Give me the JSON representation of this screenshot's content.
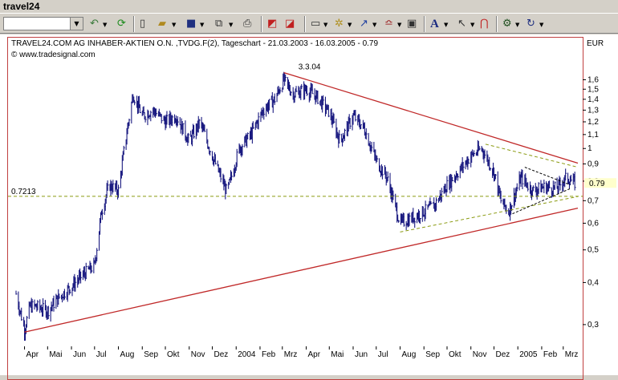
{
  "window": {
    "title": "travel24"
  },
  "toolbar": {
    "combo_value": "",
    "icons": [
      "undo-icon",
      "refresh-icon",
      "new-icon",
      "open-icon",
      "save-icon",
      "copy-icon",
      "print-icon",
      "chart-icon",
      "chart-compare-icon",
      "layout-icon",
      "indicator-icon",
      "drawing-icon",
      "scale-icon",
      "properties-icon",
      "text-icon",
      "cursor-icon",
      "magnet-icon",
      "settings-icon",
      "reload-icon"
    ]
  },
  "chart": {
    "header": "TRAVEL24.COM AG INHABER-AKTIEN O.N. ,TVDG.F(2), Tageschart - 21.03.2003 - 16.03.2005 - 0.79",
    "copyright": "© www.tradesignal.com",
    "currency": "EUR",
    "annotation_peak": "3.3.04",
    "hline_label": "0.7213",
    "last_price_label": "0.79",
    "colors": {
      "price": "#1a1a80",
      "trend": "#c02828",
      "hline": "#8a9a10",
      "background": "#ffffff"
    }
  },
  "chart_data": {
    "type": "line",
    "title": "TRAVEL24.COM AG INHABER-AKTIEN O.N. ,TVDG.F(2), Tageschart - 21.03.2003 - 16.03.2005 - 0.79",
    "xlabel": "",
    "ylabel": "EUR",
    "log_scale": true,
    "ylim": [
      0.26,
      1.85
    ],
    "x_ticks": [
      "Apr",
      "Mai",
      "Jun",
      "Jul",
      "Aug",
      "Sep",
      "Okt",
      "Nov",
      "Dez",
      "2004",
      "Feb",
      "Mrz",
      "Apr",
      "Mai",
      "Jun",
      "Jul",
      "Aug",
      "Sep",
      "Okt",
      "Nov",
      "Dez",
      "2005",
      "Feb",
      "Mrz"
    ],
    "y_ticks": [
      "1,6",
      "1,5",
      "1,4",
      "1,3",
      "1,2",
      "1,1",
      "1",
      "0,9",
      "0,8",
      "0,7",
      "0,6",
      "0,5",
      "0,4",
      "0,3"
    ],
    "series": [
      {
        "x": [
          "2003-03-21",
          "2003-04-01",
          "2003-04-08",
          "2003-04-15",
          "2003-05-01",
          "2003-05-15",
          "2003-06-01",
          "2003-06-15",
          "2003-07-01",
          "2003-07-10",
          "2003-07-20",
          "2003-08-01",
          "2003-08-10",
          "2003-08-20",
          "2003-09-01",
          "2003-09-15",
          "2003-10-01",
          "2003-10-15",
          "2003-11-01",
          "2003-11-15",
          "2003-12-01",
          "2003-12-20",
          "2004-01-05",
          "2004-01-20",
          "2004-02-05",
          "2004-02-20",
          "2004-03-03",
          "2004-03-15",
          "2004-04-01",
          "2004-04-15",
          "2004-05-01",
          "2004-05-15",
          "2004-06-01",
          "2004-06-15",
          "2004-07-01",
          "2004-07-15",
          "2004-08-01",
          "2004-08-15",
          "2004-09-01",
          "2004-09-15",
          "2004-10-01",
          "2004-10-15",
          "2004-11-01",
          "2004-11-15",
          "2004-12-01",
          "2004-12-10",
          "2004-12-20",
          "2005-01-05",
          "2005-01-20",
          "2005-02-05",
          "2005-02-20",
          "2005-03-05",
          "2005-03-16"
        ],
        "values": [
          0.37,
          0.29,
          0.34,
          0.34,
          0.33,
          0.36,
          0.39,
          0.42,
          0.45,
          0.65,
          0.78,
          0.75,
          1.05,
          1.45,
          1.25,
          1.3,
          1.2,
          1.25,
          1.05,
          1.2,
          0.95,
          0.74,
          1.0,
          1.1,
          1.3,
          1.4,
          1.6,
          1.45,
          1.5,
          1.42,
          1.28,
          1.05,
          1.25,
          1.15,
          0.92,
          0.82,
          0.6,
          0.62,
          0.65,
          0.68,
          0.78,
          0.85,
          0.95,
          1.0,
          0.85,
          0.7,
          0.65,
          0.82,
          0.75,
          0.77,
          0.76,
          0.82,
          0.79
        ]
      }
    ],
    "annotations": [
      "3.3.04",
      "0.7213",
      "0.79"
    ],
    "hline": 0.7213,
    "grid": false,
    "legend": "none"
  }
}
